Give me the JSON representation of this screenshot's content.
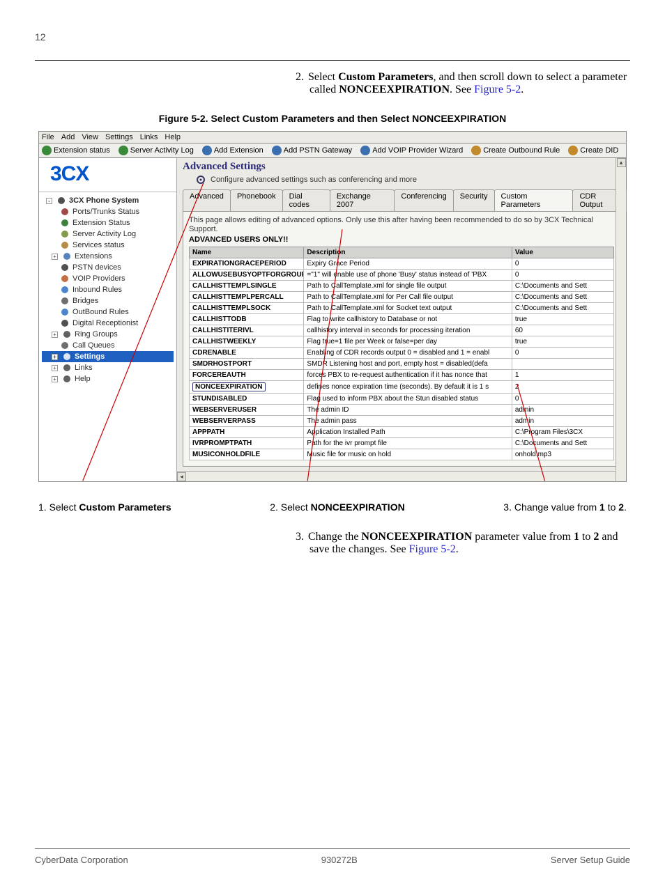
{
  "page_number": "12",
  "step2": {
    "num": "2.",
    "text_a": "Select ",
    "bold_a": "Custom Parameters",
    "text_b": ", and then scroll down to select a parameter called ",
    "bold_b": "NONCEEXPIRATION",
    "text_c": ". See ",
    "link": "Figure 5-2",
    "text_d": "."
  },
  "figure_caption": "Figure 5-2. Select Custom Parameters and then Select NONCEEXPIRATION",
  "menubar": [
    "File",
    "Add",
    "View",
    "Settings",
    "Links",
    "Help"
  ],
  "toolbar": [
    "Extension status",
    "Server Activity Log",
    "Add Extension",
    "Add PSTN Gateway",
    "Add VOIP Provider Wizard",
    "Create Outbound Rule",
    "Create DID"
  ],
  "logo": "3CX",
  "tree": [
    {
      "l": "l1",
      "exp": "-",
      "label": "3CX Phone System",
      "c": "#333"
    },
    {
      "l": "l2",
      "label": "Ports/Trunks Status",
      "c": "#912a2a"
    },
    {
      "l": "l2",
      "label": "Extension Status",
      "c": "#1b6b1b"
    },
    {
      "l": "l2",
      "label": "Server Activity Log",
      "c": "#6a8a2a"
    },
    {
      "l": "l2",
      "label": "Services status",
      "c": "#aa7725"
    },
    {
      "l": "l2e",
      "exp": "+",
      "label": "Extensions",
      "c": "#3a6fb0"
    },
    {
      "l": "l2",
      "label": "PSTN devices",
      "c": "#333"
    },
    {
      "l": "l2",
      "label": "VOIP Providers",
      "c": "#bb5522"
    },
    {
      "l": "l2",
      "label": "Inbound Rules",
      "c": "#2a6fc0"
    },
    {
      "l": "l2",
      "label": "Bridges",
      "c": "#555"
    },
    {
      "l": "l2",
      "label": "OutBound Rules",
      "c": "#2a6fc0"
    },
    {
      "l": "l2",
      "label": "Digital Receptionist",
      "c": "#333"
    },
    {
      "l": "l2e",
      "exp": "+",
      "label": "Ring Groups",
      "c": "#444"
    },
    {
      "l": "l2",
      "label": "Call Queues",
      "c": "#555"
    },
    {
      "l": "l2e",
      "exp": "+",
      "label": "Settings",
      "sel": true,
      "c": "#fff"
    },
    {
      "l": "l2e",
      "exp": "+",
      "label": "Links",
      "c": "#444"
    },
    {
      "l": "l2e",
      "exp": "+",
      "label": "Help",
      "c": "#444"
    }
  ],
  "main_header": "Advanced Settings",
  "main_sub": "Configure advanced settings such as conferencing and more",
  "tabs": [
    "Advanced",
    "Phonebook",
    "Dial codes",
    "Exchange 2007",
    "Conferencing",
    "Security",
    "Custom Parameters",
    "CDR Output"
  ],
  "active_tab_index": 6,
  "warn_line": "This page allows editing of advanced options. Only use this after having been recommended to do so by 3CX Technical Support.",
  "warn_b": "ADVANCED USERS ONLY!!",
  "table_headers": [
    "Name",
    "Description",
    "Value"
  ],
  "table_rows": [
    [
      "EXPIRATIONGRACEPERIOD",
      "Expiry Grace Period",
      "0"
    ],
    [
      "ALLOWUSEBUSYOPTFORGROUP",
      "=\"1\" will enable use of phone 'Busy' status instead of 'PBX",
      "0"
    ],
    [
      "CALLHISTTEMPLSINGLE",
      "Path to CallTemplate.xml for single file output",
      "C:\\Documents and Sett"
    ],
    [
      "CALLHISTTEMPLPERCALL",
      "Path to CallTemplate.xml for Per Call file output",
      "C:\\Documents and Sett"
    ],
    [
      "CALLHISTTEMPLSOCK",
      "Path to CallTemplate.xml for Socket text output",
      "C:\\Documents and Sett"
    ],
    [
      "CALLHISTTODB",
      "Flag to write callhistory to Database or not",
      "true"
    ],
    [
      "CALLHISTITERIVL",
      "callhistory interval in seconds for processing iteration",
      "60"
    ],
    [
      "CALLHISTWEEKLY",
      "Flag true=1 file per Week or false=per day",
      "true"
    ],
    [
      "CDRENABLE",
      "Enabling of CDR records output 0 = disabled and 1 = enabl",
      "0"
    ],
    [
      "SMDRHOSTPORT",
      "SMDR Listening host and port, empty host = disabled(defa",
      ""
    ],
    [
      "FORCEREAUTH",
      "forces PBX to re-request authentication if it has nonce that",
      "1"
    ],
    [
      "NONCEEXPIRATION",
      "defines nonce expiration time (seconds). By default it is 1 s",
      "2"
    ],
    [
      "STUNDISABLED",
      "Flag used to inform PBX about the Stun disabled status",
      "0"
    ],
    [
      "WEBSERVERUSER",
      "The admin ID",
      "admin"
    ],
    [
      "WEBSERVERPASS",
      "The admin pass",
      "admin"
    ],
    [
      "APPPATH",
      "Application Installed Path",
      "C:\\Program Files\\3CX"
    ],
    [
      "IVRPROMPTPATH",
      "Path for the ivr prompt file",
      "C:\\Documents and Sett"
    ],
    [
      "MUSICONHOLDFILE",
      "Music file for music on hold",
      "onhold.mp3"
    ]
  ],
  "boxed_row_indices": [
    11
  ],
  "callouts": [
    {
      "num": "1. ",
      "pre": "Select ",
      "bold": "Custom Parameters"
    },
    {
      "num": "2. ",
      "pre": "Select ",
      "bold": "NONCEEXPIRATION"
    },
    {
      "num": "3. ",
      "pre": "Change value from ",
      "bold": "1",
      "mid": " to ",
      "bold2": "2",
      "post": "."
    }
  ],
  "step3": {
    "num": "3.",
    "text_a": "Change the ",
    "bold_a": "NONCEEXPIRATION",
    "text_b": " parameter value from ",
    "bold_b": "1",
    "text_c": " to ",
    "bold_c": "2",
    "text_d": " and save the changes. See ",
    "link": "Figure 5-2",
    "text_e": "."
  },
  "footer": {
    "left": "CyberData Corporation",
    "mid": "930272B",
    "right": "Server Setup Guide"
  }
}
